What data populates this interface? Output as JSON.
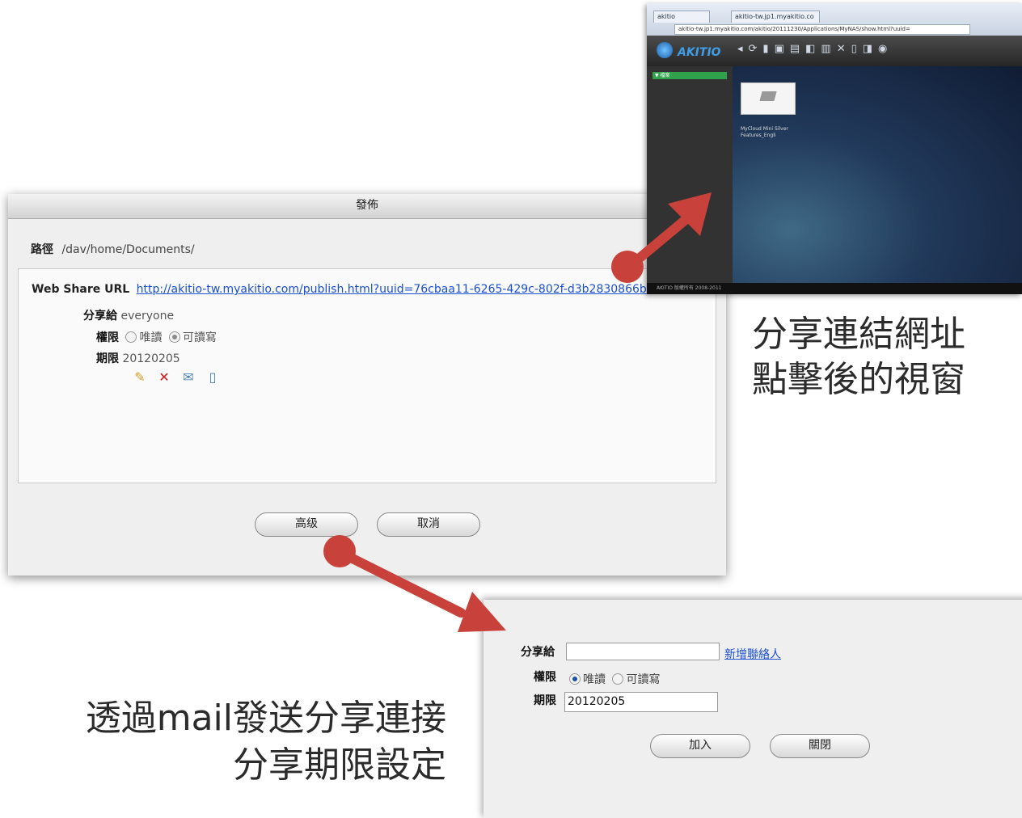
{
  "publish_dialog": {
    "title": "發佈",
    "path_label": "路徑",
    "path_value": "/dav/home/Documents/",
    "web_share_label": "Web Share URL",
    "web_share_url": "http://akitio-tw.myakitio.com/publish.html?uuid=76cbaa11-6265-429c-802f-d3b2830866bf",
    "share_to_label": "分享給",
    "share_to_value": "everyone",
    "permission_label": "權限",
    "permission_options": [
      "唯讀",
      "可讀寫"
    ],
    "permission_selected": "可讀寫",
    "expiry_label": "期限",
    "expiry_value": "20120205",
    "action_icons": [
      "pencil-icon",
      "delete-x-icon",
      "mail-icon",
      "clipboard-icon"
    ],
    "advanced_button": "高级",
    "cancel_button": "取消"
  },
  "browser_preview": {
    "address": "akitio-tw.jp1.myakitio.com/akitio/20111230/Applications/MyNAS/show.html?uuid=",
    "tab_1": "akitio",
    "tab_2": "akitio-tw.jp1.myakitio.co",
    "logo": "AKITIO",
    "sidebar_item": "▼ 檔案",
    "file_name": "MyCloud Mini Silver Features_Engli",
    "status_text": "AKITIO  版權所有 2008-2011"
  },
  "advanced_panel": {
    "share_to_label": "分享給",
    "share_to_value": "",
    "add_contact_link": "新增聯絡人",
    "permission_label": "權限",
    "permission_options": [
      "唯讀",
      "可讀寫"
    ],
    "permission_selected": "唯讀",
    "expiry_label": "期限",
    "expiry_value": "20120205",
    "add_button": "加入",
    "close_button": "關閉"
  },
  "captions": {
    "top_right_line1": "分享連結網址",
    "top_right_line2": "點擊後的視窗",
    "bottom_left_line1": "透過mail發送分享連接",
    "bottom_left_line2": "分享期限設定"
  },
  "colors": {
    "arrow": "#c8413a",
    "link": "#1a4fcf",
    "radio_selected": "#1e4fa8"
  }
}
